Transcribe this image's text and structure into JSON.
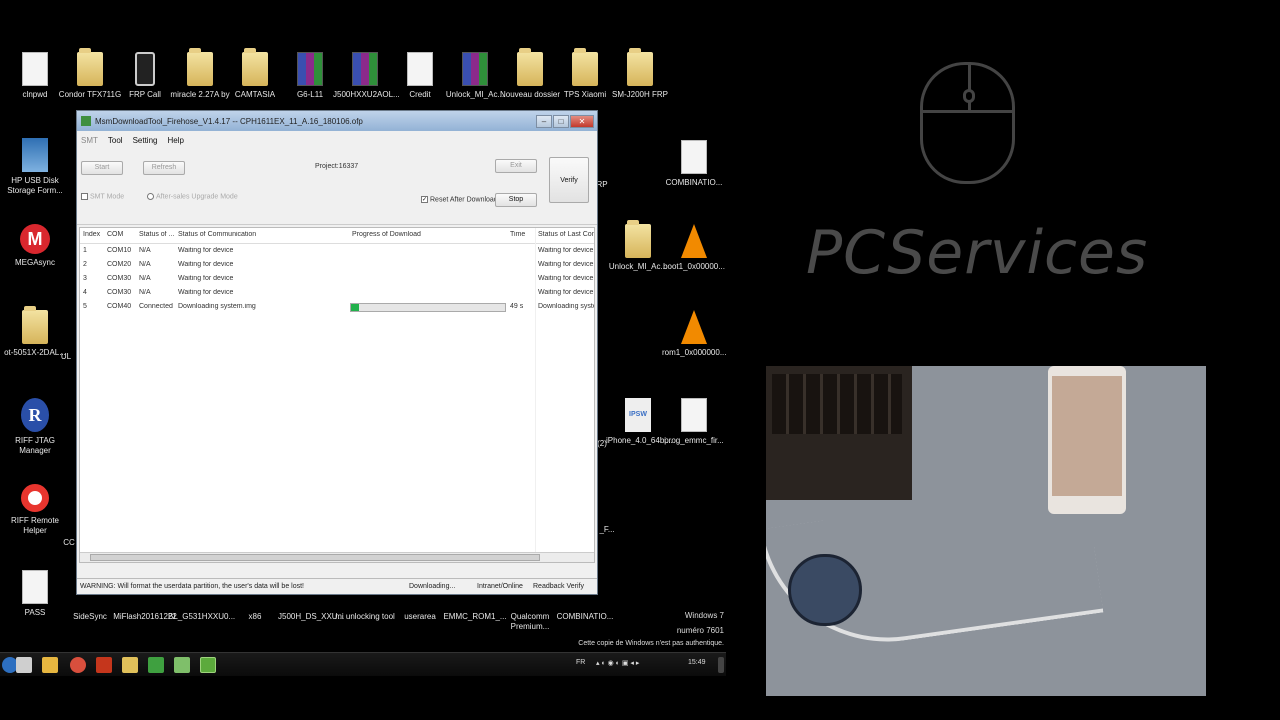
{
  "desktop": {
    "icons_top": [
      {
        "label": "clnpwd",
        "type": "file"
      },
      {
        "label": "Condor TFX711G",
        "type": "folder"
      },
      {
        "label": "FRP Call",
        "type": "phone"
      },
      {
        "label": "miracle 2.27A by",
        "type": "folder"
      },
      {
        "label": "CAMTASIA",
        "type": "folder"
      },
      {
        "label": "G6-L11",
        "type": "rar"
      },
      {
        "label": "J500HXXU2AOL...",
        "type": "rar"
      },
      {
        "label": "Credit",
        "type": "file"
      },
      {
        "label": "Unlock_MI_Ac...",
        "type": "rar"
      },
      {
        "label": "Nouveau dossier",
        "type": "folder"
      },
      {
        "label": "TPS Xiaomi",
        "type": "folder"
      },
      {
        "label": "SM-J200H FRP",
        "type": "folder"
      }
    ],
    "icons_left": [
      {
        "label": "HP USB Disk Storage Form...",
        "type": "usb"
      },
      {
        "label": "MEGAsync",
        "type": "mega"
      },
      {
        "label": "ot-5051X-2DAL...",
        "type": "folder"
      },
      {
        "label": "RIFF JTAG Manager",
        "type": "riff"
      },
      {
        "label": "RIFF Remote Helper",
        "type": "buoy"
      },
      {
        "label": "PASS",
        "type": "file"
      }
    ],
    "icons_right": [
      {
        "label": "COMBINATIO...",
        "type": "file"
      },
      {
        "label": "Unlock_MI_Ac...",
        "type": "folder"
      },
      {
        "label": "boot1_0x00000...",
        "type": "cone"
      },
      {
        "label": "rom1_0x000000...",
        "type": "cone"
      },
      {
        "label": "iPhone_4.0_64bi...",
        "type": "ipsw"
      },
      {
        "label": "prog_emmc_fir...",
        "type": "file"
      }
    ],
    "icons_bottom": [
      {
        "label": "SideSync"
      },
      {
        "label": "MiFlash20161222"
      },
      {
        "label": "BL_G531HXXU0..."
      },
      {
        "label": "x86"
      },
      {
        "label": "J500H_DS_XXU..."
      },
      {
        "label": "mi unlocking tool"
      },
      {
        "label": "userarea"
      },
      {
        "label": "EMMC_ROM1_..."
      },
      {
        "label": "Qualcomm Premium..."
      },
      {
        "label": "COMBINATIO..."
      }
    ],
    "partial_labels": {
      "left_ul": "UL",
      "rp": "RP",
      "num2": "(2)",
      "f": "_F...",
      "cc": "CC"
    }
  },
  "watermark": {
    "brand": "PCServices"
  },
  "window": {
    "title": "MsmDownloadTool_Firehose_V1.4.17 -- CPH1611EX_11_A.16_180106.ofp",
    "menu": [
      "SMT",
      "Tool",
      "Setting",
      "Help"
    ],
    "buttons": {
      "start": "Start",
      "refresh": "Refresh",
      "exit": "Exit",
      "stop": "Stop",
      "verify": "Verify"
    },
    "project": "Project:16337",
    "smt_mode": "SMT Mode",
    "after_sales": "After-sales Upgrade Mode",
    "reset_after_download": "Reset After Download",
    "columns": [
      "Index",
      "COM",
      "Status of ...",
      "Status of Communication",
      "Progress of Download",
      "Time",
      "Status of Last Comm"
    ],
    "rows": [
      {
        "index": "1",
        "com": "COM10",
        "status": "N/A",
        "comm": "Waiting for device",
        "progress": 0,
        "time": "",
        "last": "Waiting for device"
      },
      {
        "index": "2",
        "com": "COM20",
        "status": "N/A",
        "comm": "Waiting for device",
        "progress": 0,
        "time": "",
        "last": "Waiting for device"
      },
      {
        "index": "3",
        "com": "COM30",
        "status": "N/A",
        "comm": "Waiting for device",
        "progress": 0,
        "time": "",
        "last": "Waiting for device"
      },
      {
        "index": "4",
        "com": "COM30",
        "status": "N/A",
        "comm": "Waiting for device",
        "progress": 0,
        "time": "",
        "last": "Waiting for device"
      },
      {
        "index": "5",
        "com": "COM40",
        "status": "Connected",
        "comm": "Downloading system.img",
        "progress": 0.05,
        "time": "49 s",
        "last": "Downloading system"
      }
    ],
    "status": {
      "warning": "WARNING: Will format the userdata partition, the user's data will be lost!",
      "state": "Downloading...",
      "mode": "Intranet/Online",
      "verify": "Readback Verify"
    }
  },
  "taskbar": {
    "lang": "FR",
    "clock": "15:49",
    "windows_line1": "Windows 7",
    "windows_line2": "numéro 7601",
    "windows_line3": "Cette copie de Windows n'est pas authentique."
  },
  "colors": {
    "progress": "#22b14c",
    "brand": "#4a4a4a"
  }
}
